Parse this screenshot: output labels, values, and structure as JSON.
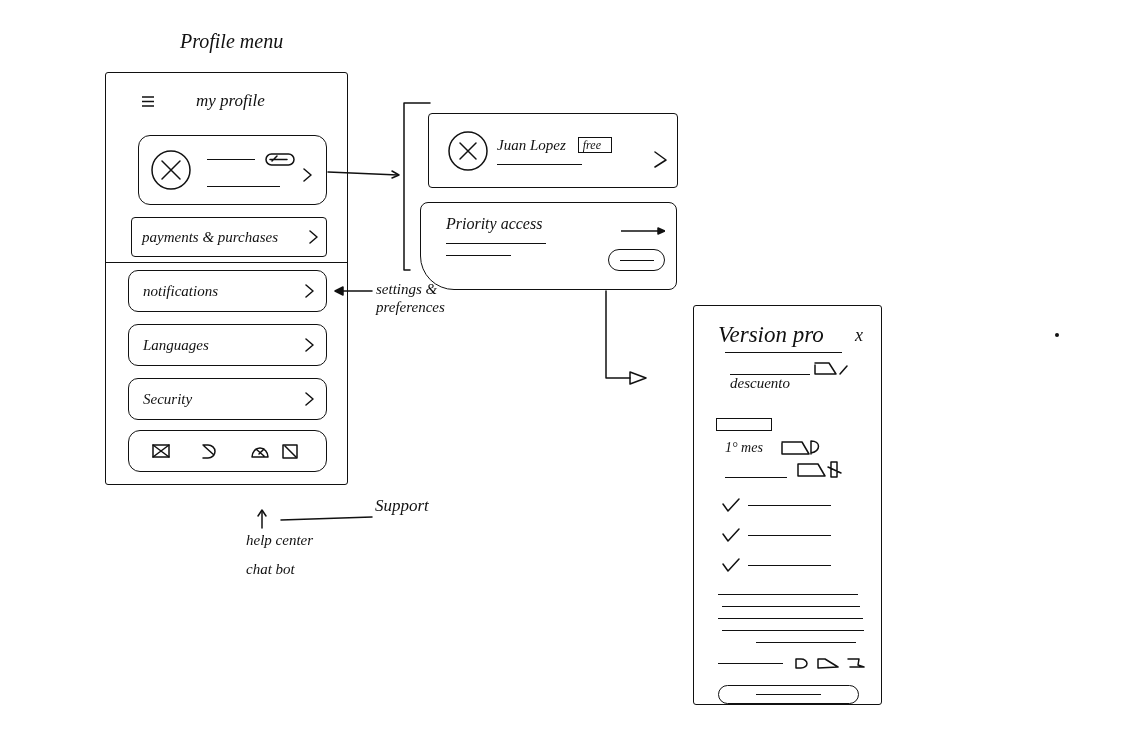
{
  "title": "Profile menu",
  "profile_screen": {
    "title": "my profile",
    "payments_item": {
      "label": "payments & purchases"
    },
    "settings_items": [
      {
        "label": "notifications"
      },
      {
        "label": "Languages"
      },
      {
        "label": "Security"
      }
    ]
  },
  "notes": {
    "settings": "settings & preferences",
    "support": "Support",
    "support_options": [
      "help center",
      "chat bot"
    ]
  },
  "profile_detail": {
    "user_card": {
      "name": "Juan Lopez",
      "plan_badge": "free"
    },
    "priority_card": {
      "title": "Priority access"
    }
  },
  "pro_modal": {
    "title": "Version pro",
    "close": "x",
    "discount_label": "descuento",
    "first_month_label": "1° mes",
    "features": [
      {
        "checked": true
      },
      {
        "checked": true
      },
      {
        "checked": true
      }
    ]
  }
}
